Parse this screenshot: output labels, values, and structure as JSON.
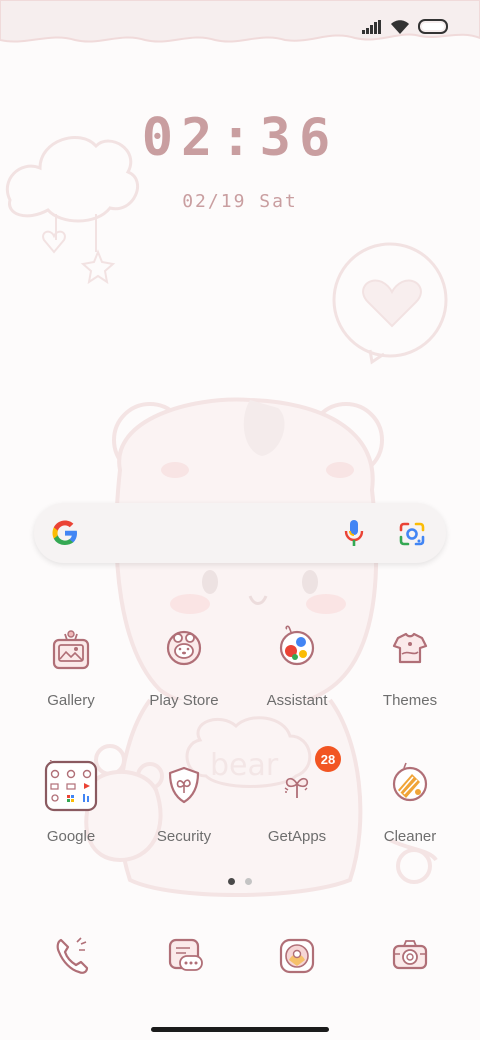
{
  "status": {
    "signal_icon": "signal-bars-icon",
    "wifi_icon": "wifi-icon",
    "battery_icon": "battery-icon"
  },
  "clock": {
    "time": "02:36",
    "date": "02/19 Sat"
  },
  "search": {
    "logo_icon": "google-g-icon",
    "mic_icon": "microphone-icon",
    "lens_icon": "google-lens-icon"
  },
  "apps_row1": [
    {
      "label": "Gallery",
      "icon": "gallery-icon"
    },
    {
      "label": "Play Store",
      "icon": "play-store-icon"
    },
    {
      "label": "Assistant",
      "icon": "assistant-icon"
    },
    {
      "label": "Themes",
      "icon": "themes-icon"
    }
  ],
  "apps_row2": [
    {
      "label": "Google",
      "icon": "google-folder-icon"
    },
    {
      "label": "Security",
      "icon": "security-icon"
    },
    {
      "label": "GetApps",
      "icon": "getapps-icon",
      "badge": "28"
    },
    {
      "label": "Cleaner",
      "icon": "cleaner-icon"
    }
  ],
  "page_indicator": {
    "pages": 2,
    "current": 1
  },
  "dock": [
    {
      "icon": "phone-icon"
    },
    {
      "icon": "messages-icon"
    },
    {
      "icon": "browser-icon"
    },
    {
      "icon": "camera-icon"
    }
  ],
  "colors": {
    "accent_pink": "#c99ea0",
    "icon_stroke": "#b06f77",
    "badge": "#f25522",
    "label": "#6e6e6e"
  }
}
